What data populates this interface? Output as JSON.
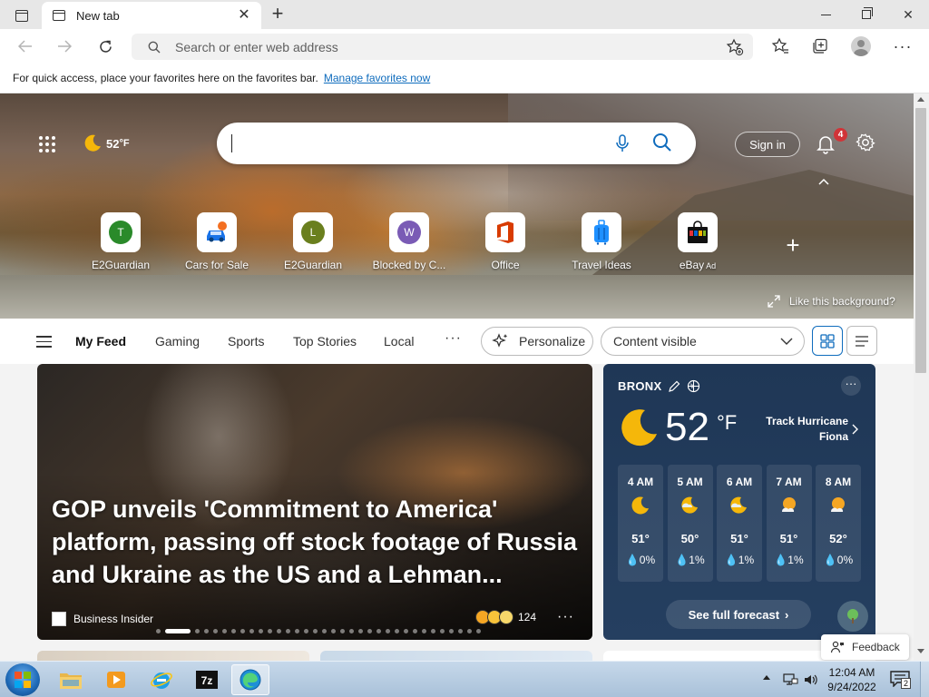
{
  "tabstrip": {
    "tab_title": "New tab"
  },
  "toolbar": {
    "address_placeholder": "Search or enter web address"
  },
  "favbar": {
    "message": "For quick access, place your favorites here on the favorites bar.",
    "link": "Manage favorites now"
  },
  "hero": {
    "weather_temp": "52",
    "weather_unit": "°F",
    "signin_label": "Sign in",
    "notification_count": "4",
    "like_background": "Like this background?",
    "quicklinks": [
      {
        "label": "E2Guardian",
        "letter": "T",
        "color": "#2a8a2a"
      },
      {
        "label": "Cars for Sale",
        "icon": "car-icon",
        "color": "#1a73e8"
      },
      {
        "label": "E2Guardian",
        "letter": "L",
        "color": "#6a7f1e"
      },
      {
        "label": "Blocked by C...",
        "letter": "W",
        "color": "#7a5bb5"
      },
      {
        "label": "Office",
        "icon": "office-icon",
        "color": "#d83b01"
      },
      {
        "label": "Travel Ideas",
        "icon": "suitcase-icon",
        "color": "#1e90ff"
      },
      {
        "label": "eBay",
        "ad": "Ad",
        "icon": "shopping-bag-icon",
        "color": "#111111"
      }
    ]
  },
  "feednav": {
    "items": [
      "My Feed",
      "Gaming",
      "Sports",
      "Top Stories",
      "Local"
    ],
    "personalize_label": "Personalize",
    "content_select_value": "Content visible"
  },
  "feed": {
    "headline": "GOP unveils 'Commitment to America' platform, passing off stock footage of Russia and Ukraine as the US and a Lehman...",
    "source": "Business Insider",
    "reaction_count": "124"
  },
  "weather_card": {
    "location": "BRONX",
    "temp": "52",
    "unit": "°F",
    "alert": "Track Hurricane Fiona",
    "see_full": "See full forecast",
    "hours": [
      {
        "time": "4 AM",
        "icon": "moon-icon",
        "temp": "51°",
        "precip": "0%"
      },
      {
        "time": "5 AM",
        "icon": "moon-cloud-icon",
        "temp": "50°",
        "precip": "1%"
      },
      {
        "time": "6 AM",
        "icon": "moon-cloud-icon",
        "temp": "51°",
        "precip": "1%"
      },
      {
        "time": "7 AM",
        "icon": "sun-cloud-icon",
        "temp": "51°",
        "precip": "1%"
      },
      {
        "time": "8 AM",
        "icon": "sun-cloud-icon",
        "temp": "52°",
        "precip": "0%"
      }
    ]
  },
  "feedback_label": "Feedback",
  "taskbar": {
    "time": "12:04 AM",
    "date": "9/24/2022",
    "notification_count": "2"
  }
}
